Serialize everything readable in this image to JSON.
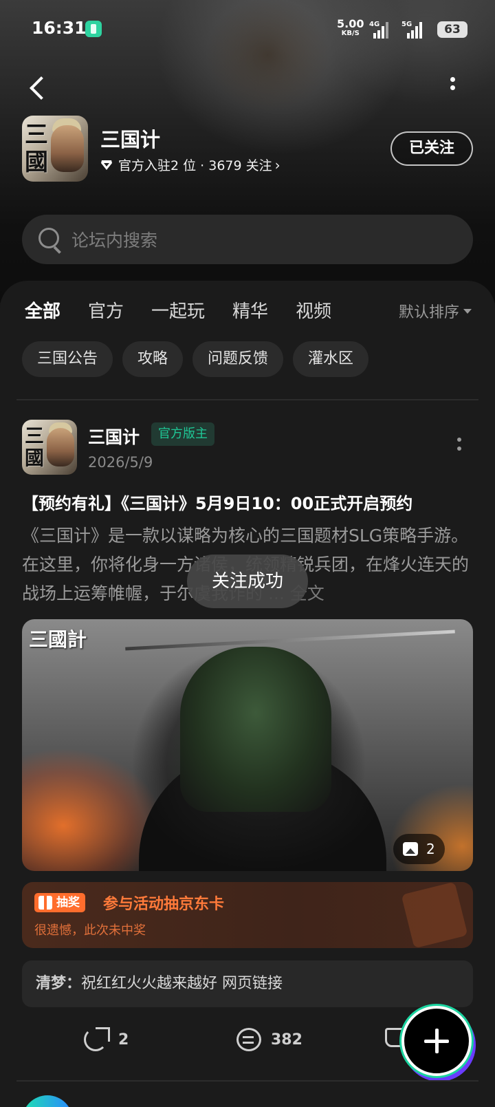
{
  "status_bar": {
    "time": "16:31",
    "net_speed": "5.00",
    "net_speed_unit": "KB/S",
    "signal_1": "4G",
    "signal_2": "5G",
    "battery": "63"
  },
  "header": {
    "forum_name": "三国计",
    "meta": "官方入驻2 位 · 3679 关注",
    "follow_label": "已关注"
  },
  "search": {
    "placeholder": "论坛内搜索"
  },
  "tabs": [
    {
      "label": "全部",
      "active": true
    },
    {
      "label": "官方"
    },
    {
      "label": "一起玩"
    },
    {
      "label": "精华"
    },
    {
      "label": "视频"
    }
  ],
  "sort_label": "默认排序",
  "chips": [
    "三国公告",
    "攻略",
    "问题反馈",
    "灌水区"
  ],
  "post": {
    "author": "三国计",
    "badge": "官方版主",
    "date": "2026/5/9",
    "title": "【预约有礼】《三国计》5月9日10：00正式开启预约",
    "body": "《三国计》是一款以谋略为核心的三国题材SLG策略手游。在这里，你将化身一方诸侯，统领精锐兵团，在烽火连天的战场上运筹帷幄，于尔虞我诈的",
    "body_more": "... 全文",
    "image_count": "2",
    "lottery_tag": "抽奖",
    "lottery_title": "参与活动抽京东卡",
    "lottery_result": "很遗憾，此次未中奖",
    "comment_user": "清梦：",
    "comment_text": "祝红红火火越来越好  网页链接",
    "share_count": "2",
    "comment_count": "382"
  },
  "toast": "关注成功",
  "icons": {
    "back": "back-arrow-icon",
    "more": "more-vertical-icon",
    "search": "search-icon",
    "diamond": "diamond-icon",
    "share": "share-icon",
    "comment": "comment-icon",
    "like": "like-icon",
    "add": "plus-icon"
  },
  "colors": {
    "accent": "#19c38e",
    "lottery": "#ff6d2d",
    "background": "#161616"
  }
}
